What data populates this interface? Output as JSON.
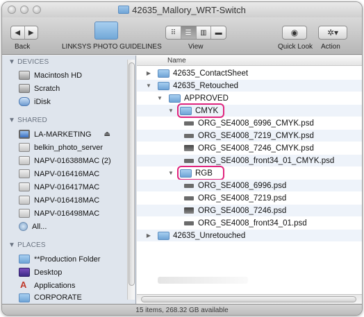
{
  "window": {
    "title": "42635_Mallory_WRT-Switch"
  },
  "toolbar": {
    "back_label": "Back",
    "favorite_label": "LINKSYS PHOTO GUIDELINES",
    "view_label": "View",
    "quicklook_label": "Quick Look",
    "action_label": "Action",
    "back_glyph": "◀",
    "forward_glyph": "▶",
    "view_modes": [
      "⠿",
      "☰",
      "▥",
      "▬"
    ],
    "active_view_index": 1,
    "quicklook_glyph": "◉",
    "action_glyph": "✲▾"
  },
  "sidebar": {
    "devices_header": "▼ DEVICES",
    "devices": [
      {
        "label": "Macintosh HD",
        "icon": "hard-disk-icon"
      },
      {
        "label": "Scratch",
        "icon": "hard-disk-icon"
      },
      {
        "label": "iDisk",
        "icon": "idisk-icon"
      }
    ],
    "shared_header": "▼ SHARED",
    "shared": [
      {
        "label": "LA-MARKETING",
        "icon": "computer-icon",
        "eject": "⏏"
      },
      {
        "label": "belkin_photo_server",
        "icon": "server-icon"
      },
      {
        "label": "NAPV-016388MAC (2)",
        "icon": "server-icon"
      },
      {
        "label": "NAPV-016416MAC",
        "icon": "server-icon"
      },
      {
        "label": "NAPV-016417MAC",
        "icon": "server-icon"
      },
      {
        "label": "NAPV-016418MAC",
        "icon": "server-icon"
      },
      {
        "label": "NAPV-016498MAC",
        "icon": "server-icon"
      },
      {
        "label": "All...",
        "icon": "network-icon"
      }
    ],
    "places_header": "▼ PLACES",
    "places": [
      {
        "label": "**Production Folder",
        "icon": "folder-icon"
      },
      {
        "label": "Desktop",
        "icon": "desktop-icon"
      },
      {
        "label": "Applications",
        "icon": "applications-icon"
      },
      {
        "label": "CORPORATE",
        "icon": "folder-icon"
      }
    ]
  },
  "list": {
    "column_header": "Name",
    "rows": [
      {
        "label": "42635_ContactSheet",
        "kind": "folder",
        "depth": 0,
        "expanded": false
      },
      {
        "label": "42635_Retouched",
        "kind": "folder",
        "depth": 0,
        "expanded": true
      },
      {
        "label": "APPROVED",
        "kind": "folder",
        "depth": 1,
        "expanded": true
      },
      {
        "label": "CMYK",
        "kind": "folder",
        "depth": 2,
        "expanded": true,
        "highlighted": true
      },
      {
        "label": "ORG_SE4008_6996_CMYK.psd",
        "kind": "psd",
        "depth": 3
      },
      {
        "label": "ORG_SE4008_7219_CMYK.psd",
        "kind": "psd",
        "depth": 3
      },
      {
        "label": "ORG_SE4008_7246_CMYK.psd",
        "kind": "psd-img",
        "depth": 3
      },
      {
        "label": "ORG_SE4008_front34_01_CMYK.psd",
        "kind": "psd",
        "depth": 3
      },
      {
        "label": "RGB",
        "kind": "folder",
        "depth": 2,
        "expanded": true,
        "highlighted": true
      },
      {
        "label": "ORG_SE4008_6996.psd",
        "kind": "psd",
        "depth": 3
      },
      {
        "label": "ORG_SE4008_7219.psd",
        "kind": "psd",
        "depth": 3
      },
      {
        "label": "ORG_SE4008_7246.psd",
        "kind": "psd-img",
        "depth": 3
      },
      {
        "label": "ORG_SE4008_front34_01.psd",
        "kind": "psd",
        "depth": 3
      },
      {
        "label": "42635_Unretouched",
        "kind": "folder",
        "depth": 0,
        "expanded": false
      }
    ]
  },
  "status": {
    "text": "15 items, 268.32 GB available"
  },
  "colors": {
    "highlight": "#e0247d",
    "sidebar_bg": "#dfe5ed",
    "stripe": "#eef3fa"
  }
}
